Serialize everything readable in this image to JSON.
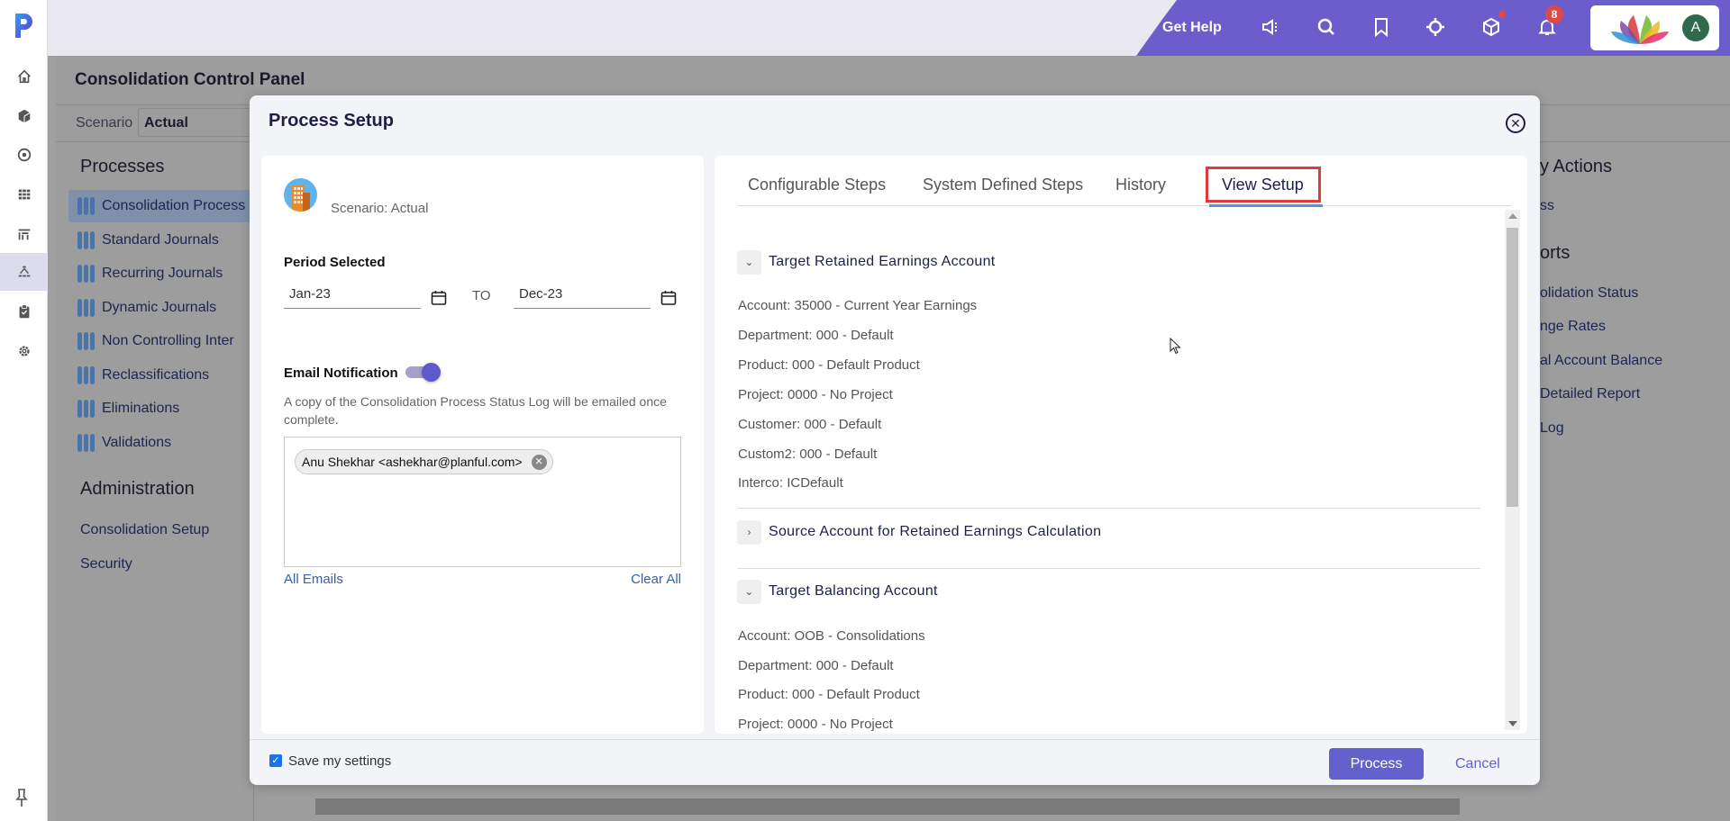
{
  "topbar": {
    "get_help": "Get Help",
    "notification_count": "8",
    "avatar_initial": "A",
    "icons": [
      "announcement-icon",
      "search-icon",
      "bookmark-icon",
      "target-icon",
      "cube-icon",
      "bell-icon"
    ]
  },
  "rail": {
    "items": [
      "home-icon",
      "cube-icon",
      "target-icon",
      "grid-icon",
      "report-icon",
      "hierarchy-icon",
      "clipboard-icon",
      "gear-icon"
    ],
    "active": "hierarchy-icon"
  },
  "background": {
    "page_title": "Consolidation Control Panel",
    "scenario_label": "Scenario",
    "scenario_value": "Actual",
    "processes_heading": "Processes",
    "processes": [
      "Consolidation Process",
      "Standard Journals",
      "Recurring Journals",
      "Dynamic Journals",
      "Non Controlling Inter",
      "Reclassifications",
      "Eliminations",
      "Validations"
    ],
    "administration_heading": "Administration",
    "admin_links": [
      "Consolidation Setup",
      "Security"
    ],
    "quick_actions_heading": "y Actions",
    "quick_action_link": "ss",
    "reports_heading": "orts",
    "report_links": [
      "olidation Status",
      "nge Rates",
      "al Account Balance",
      "Detailed Report",
      "Log"
    ]
  },
  "modal": {
    "title": "Process Setup",
    "left": {
      "scenario": "Scenario: Actual",
      "period_label": "Period Selected",
      "period_from": "Jan-23",
      "period_to_label": "TO",
      "period_to": "Dec-23",
      "email_label": "Email Notification",
      "email_enabled": true,
      "email_description": "A copy of the Consolidation Process Status Log will be emailed once complete.",
      "recipients": [
        "Anu Shekhar <ashekhar@planful.com>"
      ],
      "all_emails": "All Emails",
      "clear_all": "Clear All"
    },
    "tabs": [
      "Configurable Steps",
      "System Defined Steps",
      "History",
      "View Setup"
    ],
    "active_tab": "View Setup",
    "sections": [
      {
        "title": "Target Retained Earnings Account",
        "expanded": true,
        "fields": [
          {
            "label": "Account:",
            "value": "35000 - Current Year Earnings"
          },
          {
            "label": "Department:",
            "value": "000 - Default"
          },
          {
            "label": "Product:",
            "value": "000 - Default Product"
          },
          {
            "label": "Project:",
            "value": "0000 - No Project"
          },
          {
            "label": "Customer:",
            "value": "000 - Default"
          },
          {
            "label": "Custom2:",
            "value": "000 - Default"
          },
          {
            "label": "Interco:",
            "value": "ICDefault"
          }
        ]
      },
      {
        "title": "Source Account for Retained Earnings Calculation",
        "expanded": false,
        "fields": []
      },
      {
        "title": "Target Balancing Account",
        "expanded": true,
        "fields": [
          {
            "label": "Account:",
            "value": "OOB - Consolidations"
          },
          {
            "label": "Department:",
            "value": "000 - Default"
          },
          {
            "label": "Product:",
            "value": "000 - Default Product"
          },
          {
            "label": "Project:",
            "value": "0000 - No Project"
          }
        ]
      }
    ],
    "footer": {
      "save_settings_label": "Save my settings",
      "save_settings_checked": true,
      "process_label": "Process",
      "cancel_label": "Cancel"
    }
  },
  "colors": {
    "brand_purple": "#6c5dcc",
    "primary_button": "#6361cc",
    "highlight_red": "#e03a3a",
    "badge_red": "#e04848"
  }
}
